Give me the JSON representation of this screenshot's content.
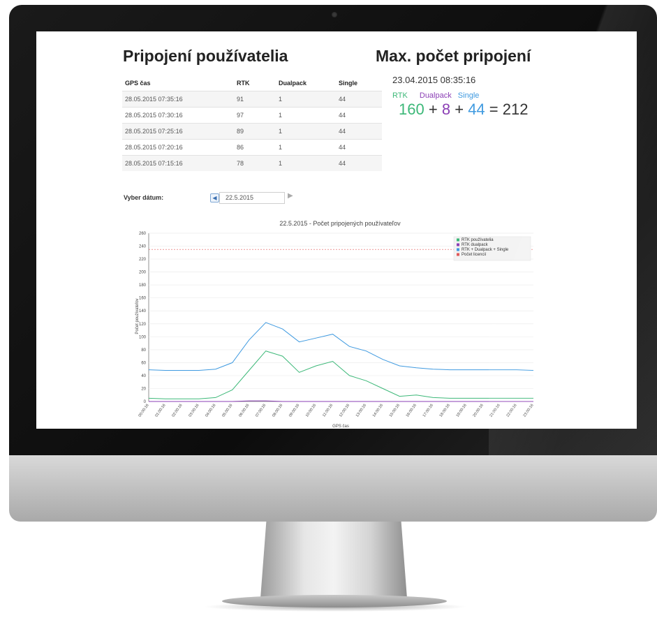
{
  "left_panel": {
    "title": "Pripojení používatelia",
    "table": {
      "headers": [
        "GPS čas",
        "RTK",
        "Dualpack",
        "Single"
      ],
      "rows": [
        [
          "28.05.2015 07:35:16",
          "91",
          "1",
          "44"
        ],
        [
          "28.05.2015 07:30:16",
          "97",
          "1",
          "44"
        ],
        [
          "28.05.2015 07:25:16",
          "89",
          "1",
          "44"
        ],
        [
          "28.05.2015 07:20:16",
          "86",
          "1",
          "44"
        ],
        [
          "28.05.2015 07:15:16",
          "78",
          "1",
          "44"
        ]
      ]
    }
  },
  "right_panel": {
    "title": "Max. počet pripojení",
    "datetime": "23.04.2015 08:35:16",
    "labels": {
      "rtk": "RTK",
      "dualpack": "Dualpack",
      "single": "Single"
    },
    "rtk_value": "160",
    "dualpack_value": "8",
    "single_value": "44",
    "total": "212",
    "plus": "+",
    "equals": "="
  },
  "date_picker": {
    "label": "Vyber dátum:",
    "value": "22.5.2015",
    "prev_icon": "◀",
    "next_icon": "▶"
  },
  "colors": {
    "rtk": "#3cb878",
    "dualpack": "#8b3fb5",
    "total": "#3f9ae0",
    "licence": "#e05a5a"
  },
  "chart_data": {
    "type": "line",
    "title": "22.5.2015 - Počet pripojených používateľov",
    "xlabel": "GPS čas",
    "ylabel": "Počet používateľov",
    "ylim": [
      0,
      260
    ],
    "yticks": [
      0,
      20,
      40,
      60,
      80,
      100,
      120,
      140,
      160,
      180,
      200,
      220,
      240,
      260
    ],
    "grid": true,
    "legend_position": "top-right",
    "x": [
      "00:00:16",
      "01:00:16",
      "02:00:16",
      "03:00:16",
      "04:00:16",
      "05:00:16",
      "06:00:16",
      "07:00:16",
      "08:00:16",
      "09:00:16",
      "10:00:16",
      "11:00:16",
      "12:00:16",
      "13:00:16",
      "14:00:16",
      "15:00:16",
      "16:00:16",
      "17:00:16",
      "18:00:16",
      "19:00:16",
      "20:00:16",
      "21:00:16",
      "22:00:16",
      "23:00:16"
    ],
    "series": [
      {
        "name": "RTK používatelia",
        "color": "#3cb878",
        "values": [
          5,
          4,
          4,
          4,
          6,
          18,
          48,
          78,
          70,
          45,
          55,
          62,
          40,
          32,
          20,
          8,
          10,
          6,
          5,
          5,
          5,
          5,
          5,
          5
        ]
      },
      {
        "name": "RTK dualpack",
        "color": "#8b3fb5",
        "values": [
          0,
          0,
          0,
          0,
          0,
          0,
          1,
          1,
          0,
          0,
          0,
          0,
          0,
          0,
          0,
          0,
          0,
          0,
          0,
          0,
          0,
          0,
          0,
          0
        ]
      },
      {
        "name": "RTK + Dualpack + Single",
        "color": "#3f9ae0",
        "values": [
          49,
          48,
          48,
          48,
          50,
          60,
          95,
          122,
          112,
          92,
          98,
          104,
          85,
          78,
          65,
          55,
          52,
          50,
          49,
          49,
          49,
          49,
          49,
          48
        ]
      },
      {
        "name": "Počet licencií",
        "color": "#e05a5a",
        "dashed": true,
        "values": [
          235,
          235,
          235,
          235,
          235,
          235,
          235,
          235,
          235,
          235,
          235,
          235,
          235,
          235,
          235,
          235,
          235,
          235,
          235,
          235,
          235,
          235,
          235,
          235
        ]
      }
    ]
  }
}
